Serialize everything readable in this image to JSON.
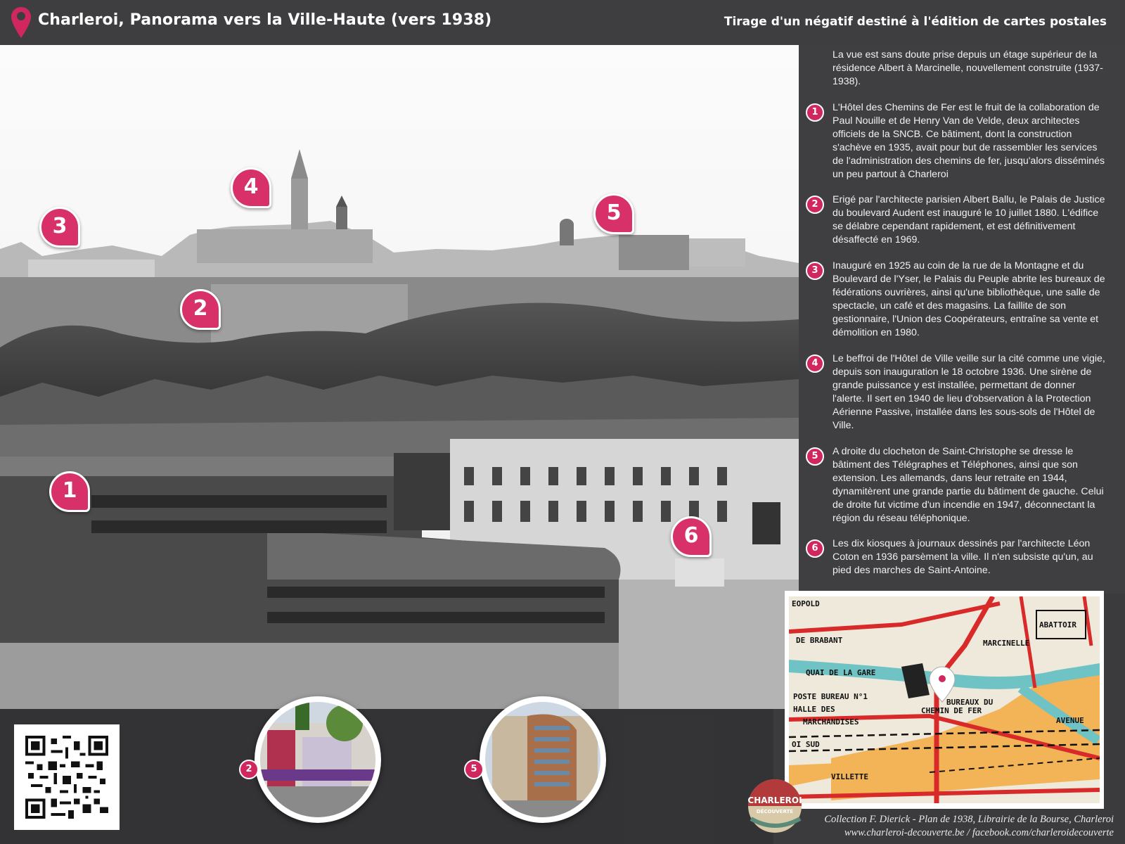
{
  "header": {
    "title": "Charleroi, Panorama vers la Ville-Haute (vers 1938)",
    "subtitle": "Tirage d'un négatif destiné à l'édition de cartes postales"
  },
  "intro": "La vue est sans doute prise depuis un étage supérieur de la résidence Albert à Marcinelle, nouvellement construite (1937-1938).",
  "items": [
    {
      "num": "1",
      "text": "L'Hôtel des Chemins de Fer est le fruit de la collaboration de Paul Nouille et de Henry Van de Velde, deux architectes officiels de la SNCB. Ce bâtiment, dont la construction s'achève en 1935, avait pour but de rassembler les services de l'administration des chemins de fer, jusqu'alors disséminés un peu partout à Charleroi"
    },
    {
      "num": "2",
      "text": "Erigé par l'architecte parisien Albert Ballu, le Palais de Justice du boulevard Audent est inauguré le 10 juillet 1880. L'édifice se délabre cependant rapidement, et est définitivement désaffecté en 1969."
    },
    {
      "num": "3",
      "text": "Inauguré en 1925 au coin de la rue de la Montagne et du Boulevard de l'Yser, le Palais du Peuple abrite les bureaux de fédérations ouvrières, ainsi qu'une bibliothèque, une salle de spectacle, un café et des magasins. La faillite de son gestionnaire, l'Union des Coopérateurs, entraîne sa vente et démolition en 1980."
    },
    {
      "num": "4",
      "text": "Le beffroi de l'Hôtel de Ville veille sur la cité comme une vigie, depuis son inauguration le 18 octobre 1936. Une sirène de grande puissance y est installée, permettant de donner l'alerte. Il sert en 1940 de lieu d'observation à la Protection Aérienne Passive, installée dans les sous-sols de l'Hôtel de Ville."
    },
    {
      "num": "5",
      "text": "A droite du clocheton de Saint-Christophe se dresse le bâtiment des Télégraphes et Téléphones, ainsi que son extension. Les allemands, dans leur retraite en 1944, dynamitèrent une grande partie du bâtiment de gauche. Celui de droite fut victime d'un incendie en 1947, déconnectant la région du réseau téléphonique."
    },
    {
      "num": "6",
      "text": "Les dix kiosques à journaux dessinés par l'architecte Léon Coton en 1936 parsèment la ville. Il n'en subsiste qu'un, au pied des marches de Saint-Antoine."
    }
  ],
  "markers": [
    "1",
    "2",
    "3",
    "4",
    "5",
    "6"
  ],
  "circles": [
    {
      "num": "2"
    },
    {
      "num": "5"
    }
  ],
  "map_labels": {
    "quai": "QUAI DE LA GARE",
    "poste": "POSTE BUREAU N°1",
    "halle": "HALLE DES",
    "marchandises": "MARCHANDISES",
    "bureaux": "BUREAUX DU",
    "chemin": "CHEMIN DE FER",
    "abattoir": "ABATTOIR",
    "brabant": "DE BRABANT",
    "sud": "OI SUD",
    "villette": "VILLETTE",
    "marcinelle": "MARCINELLE",
    "avenue": "AVENUE",
    "eopold": "EOPOLD"
  },
  "logo_text": "CHARLEROI",
  "logo_sub": "DÉCOUVERTE",
  "credits": {
    "line1": "Collection F. Dierick - Plan de 1938, Librairie de la Bourse, Charleroi",
    "line2": "www.charleroi-decouverte.be  /  facebook.com/charleroidecouverte"
  },
  "colors": {
    "accent": "#d0285e",
    "header_bg": "#3e3e40"
  }
}
